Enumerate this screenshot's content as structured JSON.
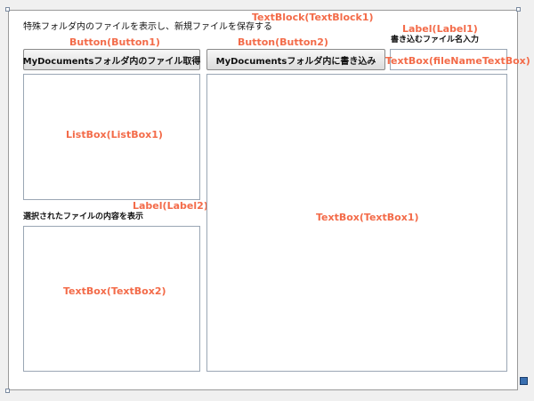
{
  "textblock1": {
    "text": "特殊フォルダ内のファイルを表示し、新規ファイルを保存する",
    "overlay": "TextBlock(TextBlock1)"
  },
  "button1": {
    "label": "MyDocumentsフォルダ内のファイル取得",
    "overlay": "Button(Button1)"
  },
  "button2": {
    "label": "MyDocumentsフォルダ内に書き込み",
    "overlay": "Button(Button2)"
  },
  "label1": {
    "text": "書き込むファイル名入力",
    "overlay": "Label(Label1)"
  },
  "filename_textbox": {
    "value": "",
    "overlay": "TextBox(fileNameTextBox)"
  },
  "listbox1": {
    "overlay": "ListBox(ListBox1)"
  },
  "label2": {
    "text": "選択されたファイルの内容を表示",
    "overlay": "Label(Label2)"
  },
  "textbox2": {
    "value": "",
    "overlay": "TextBox(TextBox2)"
  },
  "textbox1": {
    "value": "",
    "overlay": "TextBox(TextBox1)"
  },
  "colors": {
    "overlay": "#f36b49",
    "border": "#9aa6b4"
  }
}
